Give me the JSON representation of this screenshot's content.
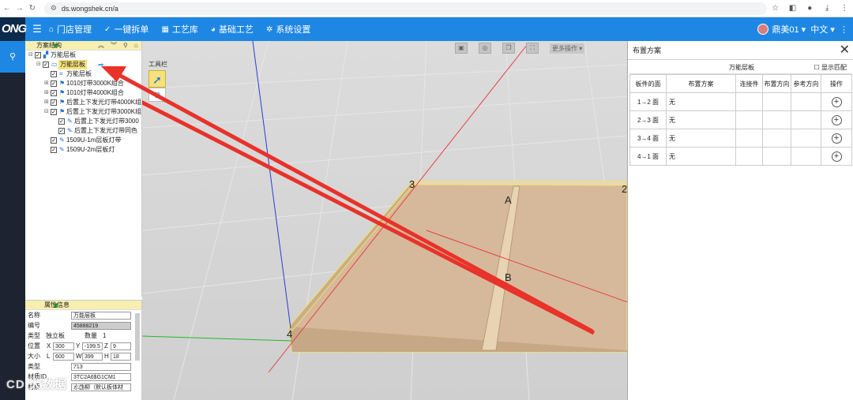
{
  "browser": {
    "url": "ds.wongshek.cn/a",
    "tune_icon": "tune-icon"
  },
  "app": {
    "logo": "ONG",
    "menu": [
      {
        "icon": "home-icon",
        "label": "门店管理"
      },
      {
        "icon": "check-circle-icon",
        "label": "一键拆单"
      },
      {
        "icon": "grid-icon",
        "label": "工艺库"
      },
      {
        "icon": "palette-icon",
        "label": "基础工艺"
      },
      {
        "icon": "gear-icon",
        "label": "系统设置"
      }
    ],
    "user": "鼎美01",
    "lang": "中文"
  },
  "tree": {
    "title": "方案结构",
    "nodes": [
      {
        "label": "万能层板",
        "level": 0,
        "expand": "⊟",
        "icon": "folder-icon"
      },
      {
        "label": "万能层板",
        "level": 1,
        "expand": "⊟",
        "icon": "shelf-icon",
        "selected": true
      },
      {
        "label": "万能层板",
        "level": 2,
        "expand": "",
        "icon": "panel-icon"
      },
      {
        "label": "1010灯带3000K组合",
        "level": 2,
        "expand": "⊞",
        "icon": "flag-icon"
      },
      {
        "label": "1010灯带4000K组合",
        "level": 2,
        "expand": "⊞",
        "icon": "flag-icon"
      },
      {
        "label": "后置上下发光灯带4000K组",
        "level": 2,
        "expand": "⊞",
        "icon": "flag-icon"
      },
      {
        "label": "后置上下发光灯带3000K组",
        "level": 2,
        "expand": "⊟",
        "icon": "flag-icon"
      },
      {
        "label": "后置上下发光灯带3000",
        "level": 3,
        "expand": "",
        "icon": "light-icon"
      },
      {
        "label": "后置上下发光灯带同色",
        "level": 3,
        "expand": "",
        "icon": "light-icon"
      },
      {
        "label": "1509U-1m层板灯带",
        "level": 2,
        "expand": "",
        "icon": "light-icon"
      },
      {
        "label": "1509U-2m层板灯",
        "level": 2,
        "expand": "",
        "icon": "light-icon"
      }
    ]
  },
  "props": {
    "title": "属性信息",
    "name_label": "名称",
    "name_value": "万能层板",
    "code_label": "编号",
    "code_value": "45888219",
    "type_label": "类型",
    "type_value": "独立板",
    "qty_label": "数量",
    "qty_value": "1",
    "pos_label": "位置",
    "x_label": "X",
    "x_value": "300",
    "y_label": "Y",
    "y_value": "-199.5",
    "z_label": "Z",
    "z_value": "9",
    "size_label": "大小",
    "l_label": "L",
    "l_value": "600",
    "w_label": "W",
    "w_value": "399",
    "h_label": "H",
    "h_value": "18",
    "kind_label": "类型",
    "kind_value": "713",
    "matcode_label": "材质ID",
    "matcode_value": "3TC2A6$G1CM1",
    "mat_label": "材质",
    "mat_value": "水曲柳（默认板体材"
  },
  "viewport": {
    "toolbar_title": "工具栏",
    "more_label": "更多操作",
    "labels": {
      "c3": "3",
      "c2": "2",
      "c4": "4",
      "a": "A",
      "b": "B"
    }
  },
  "layout": {
    "title": "布置方案",
    "subtitle": "万能层板",
    "match_label": "显示匹配",
    "headers": [
      "板件的面",
      "布置方案",
      "连接件",
      "布置方向",
      "参考方向",
      "操作"
    ],
    "rows": [
      {
        "face": "1→2 面",
        "scheme": "无"
      },
      {
        "face": "2→3 面",
        "scheme": "无"
      },
      {
        "face": "3→4 面",
        "scheme": "无"
      },
      {
        "face": "4→1 面",
        "scheme": "无"
      }
    ]
  },
  "watermark": "CD 大数据 …",
  "colors": {
    "header": "#1e87e4",
    "rail": "#1d2330",
    "board": "#d6b99b",
    "highlight": "#f6e27a",
    "arrow": "#e8322a"
  }
}
